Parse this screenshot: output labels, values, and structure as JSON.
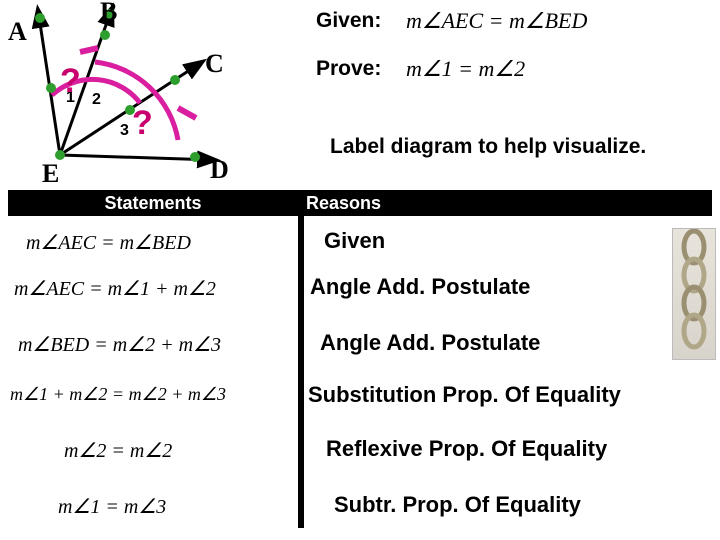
{
  "given": {
    "label": "Given:",
    "formula": "m∠AEC = m∠BED"
  },
  "prove": {
    "label": "Prove:",
    "formula": "m∠1 = m∠2"
  },
  "visualize": "Label diagram to help visualize.",
  "headers": {
    "statements": "Statements",
    "reasons": "Reasons"
  },
  "diagram": {
    "points": {
      "A": "A",
      "B": "B",
      "C": "C",
      "D": "D",
      "E": "E"
    },
    "angles": {
      "one": "1",
      "two": "2",
      "three": "3"
    },
    "marks": {
      "q1": "?",
      "q2": "?"
    }
  },
  "proof": [
    {
      "stmt": "m∠AEC = m∠BED",
      "reason": "Given"
    },
    {
      "stmt": "m∠AEC = m∠1 + m∠2",
      "reason": "Angle Add. Postulate"
    },
    {
      "stmt": "m∠BED = m∠2 + m∠3",
      "reason": "Angle Add. Postulate"
    },
    {
      "stmt": "m∠1 + m∠2 = m∠2 + m∠3",
      "reason": "Substitution Prop. Of Equality"
    },
    {
      "stmt": "m∠2 = m∠2",
      "reason": "Reflexive Prop. Of Equality"
    },
    {
      "stmt": "m∠1 = m∠3",
      "reason": "Subtr. Prop. Of Equality"
    }
  ]
}
